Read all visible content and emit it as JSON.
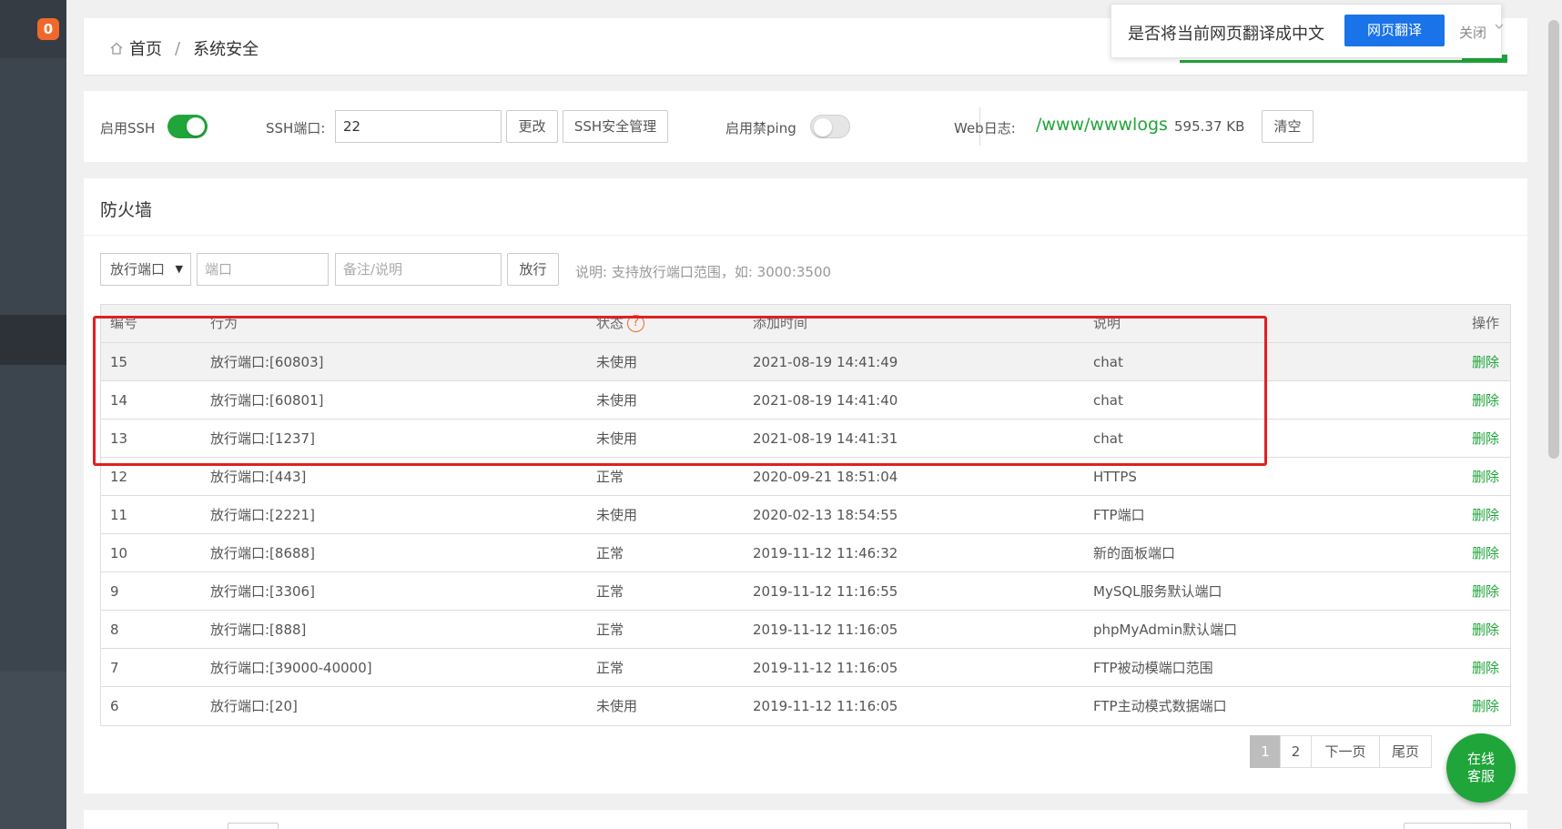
{
  "sidebar": {
    "badge_count": "0"
  },
  "breadcrumb": {
    "home": "首页",
    "separator": "/",
    "current": "系统安全"
  },
  "translate_bar": {
    "question": "是否将当前网页翻译成中文",
    "translate_button": "网页翻译",
    "close_label": "关闭"
  },
  "ssh": {
    "enable_label": "启用SSH",
    "enabled": true,
    "port_label": "SSH端口:",
    "port_value": "22",
    "change_button": "更改",
    "manage_button": "SSH安全管理",
    "ping_label": "启用禁ping",
    "ping_enabled": false,
    "weblog_label": "Web日志:",
    "weblog_path": "/www/wwwlogs",
    "weblog_size": "595.37 KB",
    "clear_button": "清空"
  },
  "firewall": {
    "title": "防火墙",
    "select_value": "放行端口",
    "port_placeholder": "端口",
    "note_placeholder": "备注/说明",
    "allow_button": "放行",
    "hint": "说明: 支持放行端口范围，如: 3000:3500",
    "columns": {
      "id": "编号",
      "action": "行为",
      "status": "状态",
      "status_help": "?",
      "time": "添加时间",
      "desc": "说明",
      "op": "操作"
    },
    "rows": [
      {
        "id": "15",
        "action": "放行端口:[60803]",
        "status": "未使用",
        "time": "2021-08-19 14:41:49",
        "desc": "chat",
        "op": "删除"
      },
      {
        "id": "14",
        "action": "放行端口:[60801]",
        "status": "未使用",
        "time": "2021-08-19 14:41:40",
        "desc": "chat",
        "op": "删除"
      },
      {
        "id": "13",
        "action": "放行端口:[1237]",
        "status": "未使用",
        "time": "2021-08-19 14:41:31",
        "desc": "chat",
        "op": "删除"
      },
      {
        "id": "12",
        "action": "放行端口:[443]",
        "status": "正常",
        "time": "2020-09-21 18:51:04",
        "desc": "HTTPS",
        "op": "删除"
      },
      {
        "id": "11",
        "action": "放行端口:[2221]",
        "status": "未使用",
        "time": "2020-02-13 18:54:55",
        "desc": "FTP端口",
        "op": "删除"
      },
      {
        "id": "10",
        "action": "放行端口:[8688]",
        "status": "正常",
        "time": "2019-11-12 11:46:32",
        "desc": "新的面板端口",
        "op": "删除"
      },
      {
        "id": "9",
        "action": "放行端口:[3306]",
        "status": "正常",
        "time": "2019-11-12 11:16:55",
        "desc": "MySQL服务默认端口",
        "op": "删除"
      },
      {
        "id": "8",
        "action": "放行端口:[888]",
        "status": "正常",
        "time": "2019-11-12 11:16:05",
        "desc": "phpMyAdmin默认端口",
        "op": "删除"
      },
      {
        "id": "7",
        "action": "放行端口:[39000-40000]",
        "status": "正常",
        "time": "2019-11-12 11:16:05",
        "desc": "FTP被动模端口范围",
        "op": "删除"
      },
      {
        "id": "6",
        "action": "放行端口:[20]",
        "status": "未使用",
        "time": "2019-11-12 11:16:05",
        "desc": "FTP主动模式数据端口",
        "op": "删除"
      }
    ],
    "pagination": {
      "current": "1",
      "page2": "2",
      "next": "下一页",
      "last": "尾页"
    }
  },
  "chat_widget": {
    "line1": "在线",
    "line2": "客服"
  },
  "colors": {
    "accent_green": "#20a53a",
    "highlight_red": "#e02020",
    "badge_orange": "#f0692a",
    "translate_blue": "#1a73e8"
  }
}
